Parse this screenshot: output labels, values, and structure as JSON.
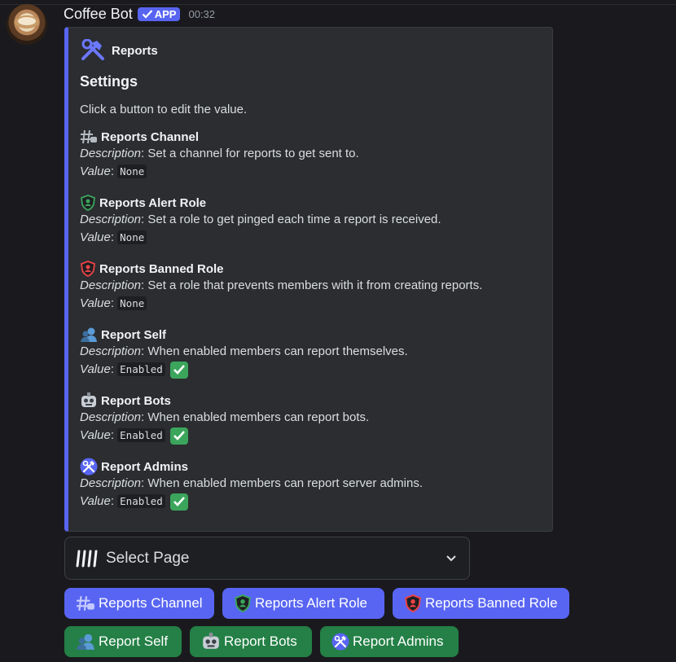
{
  "message": {
    "author": "Coffee Bot",
    "badge": "APP",
    "timestamp": "00:32"
  },
  "embed": {
    "author": "Reports",
    "title": "Settings",
    "description": "Click a button to edit the value.",
    "description_label": "Description",
    "value_label": "Value",
    "accent_color": "#5865f2",
    "fields": [
      {
        "name": "Reports Channel",
        "icon": "hashtag-chat-icon",
        "description": ": Set a channel for reports to get sent to.",
        "value": "None"
      },
      {
        "name": "Reports Alert Role",
        "icon": "green-shield-icon",
        "description": ": Set a role to get pinged each time a report is received.",
        "value": "None"
      },
      {
        "name": "Reports Banned Role",
        "icon": "red-shield-icon",
        "description": ": Set a role that prevents members with it from creating reports.",
        "value": "None"
      },
      {
        "name": "Report Self",
        "icon": "user-icon",
        "description": ": When enabled members can report themselves.",
        "value": "Enabled"
      },
      {
        "name": "Report Bots",
        "icon": "robot-icon",
        "description": ": When enabled members can report bots.",
        "value": "Enabled"
      },
      {
        "name": "Report Admins",
        "icon": "tools-icon",
        "description": ": When enabled members can report server admins.",
        "value": "Enabled"
      }
    ]
  },
  "select_menu": {
    "placeholder": "Select Page"
  },
  "buttons": {
    "row1": [
      "Reports Channel",
      "Reports Alert Role",
      "Reports Banned Role"
    ],
    "row2": [
      "Report Self",
      "Report Bots",
      "Report Admins"
    ]
  },
  "colors": {
    "blurple": "#5865f2",
    "green": "#248046",
    "background": "#1a1a1e",
    "embed": "#2b2d31"
  }
}
